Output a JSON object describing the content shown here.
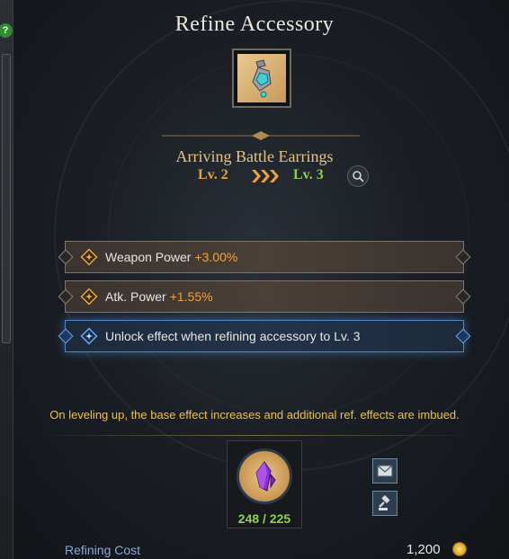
{
  "window": {
    "title": "Refine Accessory"
  },
  "item": {
    "name": "Arriving Battle Earrings",
    "level_from": "Lv. 2",
    "level_to": "Lv. 3",
    "arrows": "»»»"
  },
  "effects": [
    {
      "label": "Weapon Power",
      "value": "+3.00%"
    },
    {
      "label": "Atk. Power",
      "value": "+1.55%"
    },
    {
      "label": "Unlock effect when refining accessory to Lv. 3",
      "value": ""
    }
  ],
  "notice": "On leveling up, the base effect increases and additional ref. effects are imbued.",
  "material": {
    "count": "248 / 225"
  },
  "cost": {
    "label": "Refining Cost",
    "value": "1,200"
  },
  "help": "?",
  "colors": {
    "title": "#ece7dc",
    "level_from": "#e3a63a",
    "level_to": "#8fd14a",
    "stat_value": "#f0a23a",
    "notice": "#f1c040",
    "cost_label": "#8aa7d8",
    "unlock_glow": "#4f86c8"
  }
}
